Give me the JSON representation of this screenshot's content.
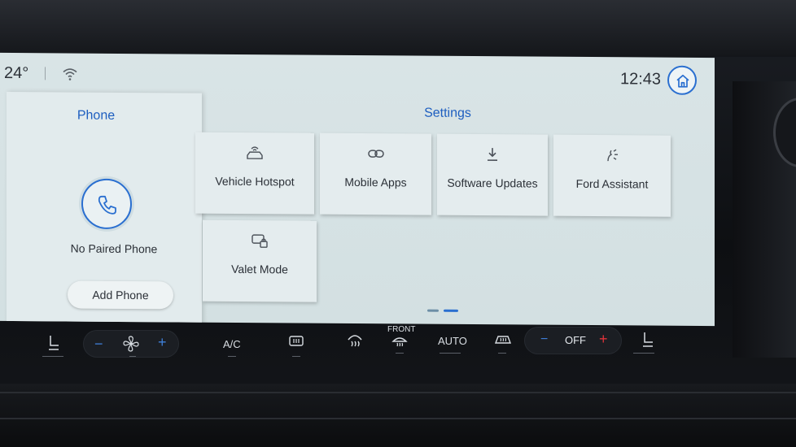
{
  "status": {
    "temperature": "24°",
    "time": "12:43"
  },
  "phone_panel": {
    "title": "Phone",
    "status_text": "No Paired Phone",
    "add_button_label": "Add Phone"
  },
  "settings": {
    "title": "Settings",
    "tiles": [
      {
        "label": "Vehicle Hotspot",
        "icon": "hotspot-icon"
      },
      {
        "label": "Mobile Apps",
        "icon": "link-icon"
      },
      {
        "label": "Software Updates",
        "icon": "download-icon"
      },
      {
        "label": "Ford Assistant",
        "icon": "assistant-icon"
      },
      {
        "label": "Valet Mode",
        "icon": "valet-lock-icon"
      }
    ]
  },
  "climate": {
    "fan_minus": "−",
    "fan_plus": "+",
    "ac_label": "A/C",
    "front_label": "FRONT",
    "auto_label": "AUTO",
    "temp_minus": "−",
    "temp_value": "OFF",
    "temp_plus": "+"
  },
  "colors": {
    "accent": "#2a6fd0",
    "screen_bg": "#d6e2e4",
    "heat_red": "#e0333a"
  }
}
